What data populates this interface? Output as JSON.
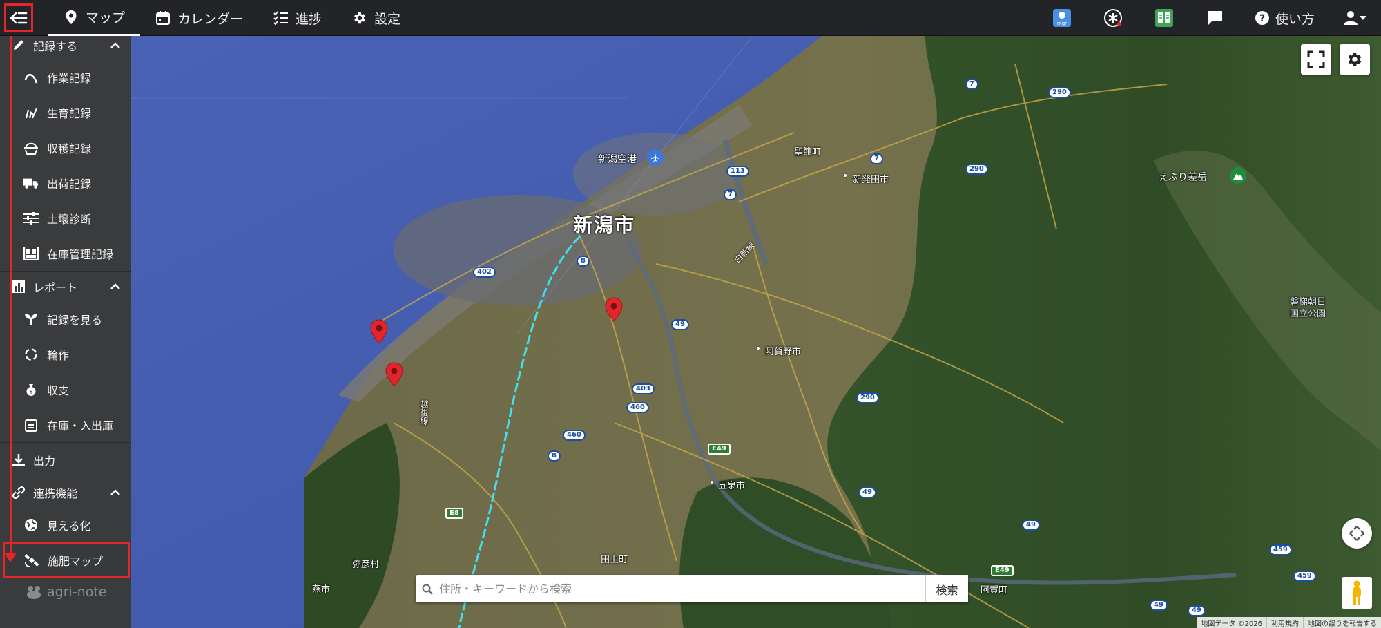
{
  "topbar": {
    "nav": [
      {
        "label": "マップ",
        "icon": "map-pin-icon",
        "active": true
      },
      {
        "label": "カレンダー",
        "icon": "calendar-icon",
        "active": false
      },
      {
        "label": "進捗",
        "icon": "checklist-icon",
        "active": false
      },
      {
        "label": "設定",
        "icon": "gear-icon",
        "active": false
      }
    ],
    "help_label": "使い方",
    "app_badge_text": "mgr"
  },
  "sidebar": {
    "record_section": {
      "label": "記録する"
    },
    "record_items": [
      {
        "label": "作業記録",
        "icon": "hoe-icon"
      },
      {
        "label": "生育記録",
        "icon": "sprout-icon"
      },
      {
        "label": "収穫記録",
        "icon": "basket-icon"
      },
      {
        "label": "出荷記録",
        "icon": "truck-icon"
      },
      {
        "label": "土壌診断",
        "icon": "sliders-icon"
      },
      {
        "label": "在庫管理記録",
        "icon": "inventory-icon"
      }
    ],
    "report_section": {
      "label": "レポート"
    },
    "report_items": [
      {
        "label": "記録を見る",
        "icon": "seedling-icon"
      },
      {
        "label": "輪作",
        "icon": "rotation-icon"
      },
      {
        "label": "収支",
        "icon": "money-bag-icon"
      },
      {
        "label": "在庫・入出庫",
        "icon": "clipboard-icon"
      }
    ],
    "output_section": {
      "label": "出力"
    },
    "link_section": {
      "label": "連携機能"
    },
    "link_items": [
      {
        "label": "見える化",
        "icon": "globe-icon"
      },
      {
        "label": "施肥マップ",
        "icon": "satellite-icon"
      }
    ],
    "brand": "agri-note"
  },
  "map": {
    "labels": {
      "niigata_city": "新潟市",
      "airport": "新潟空港",
      "seiro": "聖籠町",
      "shibata": "新発田市",
      "eburi": "えぶり差岳",
      "bandai_asahi_1": "磐梯朝日",
      "bandai_asahi_2": "国立公園",
      "agano": "阿賀野市",
      "gosen": "五泉市",
      "tagami": "田上町",
      "yahiko": "弥彦村",
      "tsubame": "燕市",
      "aga": "阿賀町",
      "hakushin": "白新線",
      "etsugo": "越後線"
    },
    "routes": [
      "290",
      "7",
      "113",
      "7",
      "290",
      "8",
      "402",
      "49",
      "403",
      "460",
      "460",
      "8",
      "290",
      "E49",
      "49",
      "E8",
      "49",
      "459",
      "459",
      "E49",
      "49",
      "49"
    ],
    "search": {
      "placeholder": "住所・キーワードから検索",
      "button": "検索"
    },
    "footer": [
      "地図データ ©2026",
      "利用規約",
      "地図の誤りを報告する"
    ],
    "colors": {
      "accent_red": "#e5252a",
      "pin_red": "#e0262c",
      "rail_cyan": "#40e0f0"
    }
  }
}
